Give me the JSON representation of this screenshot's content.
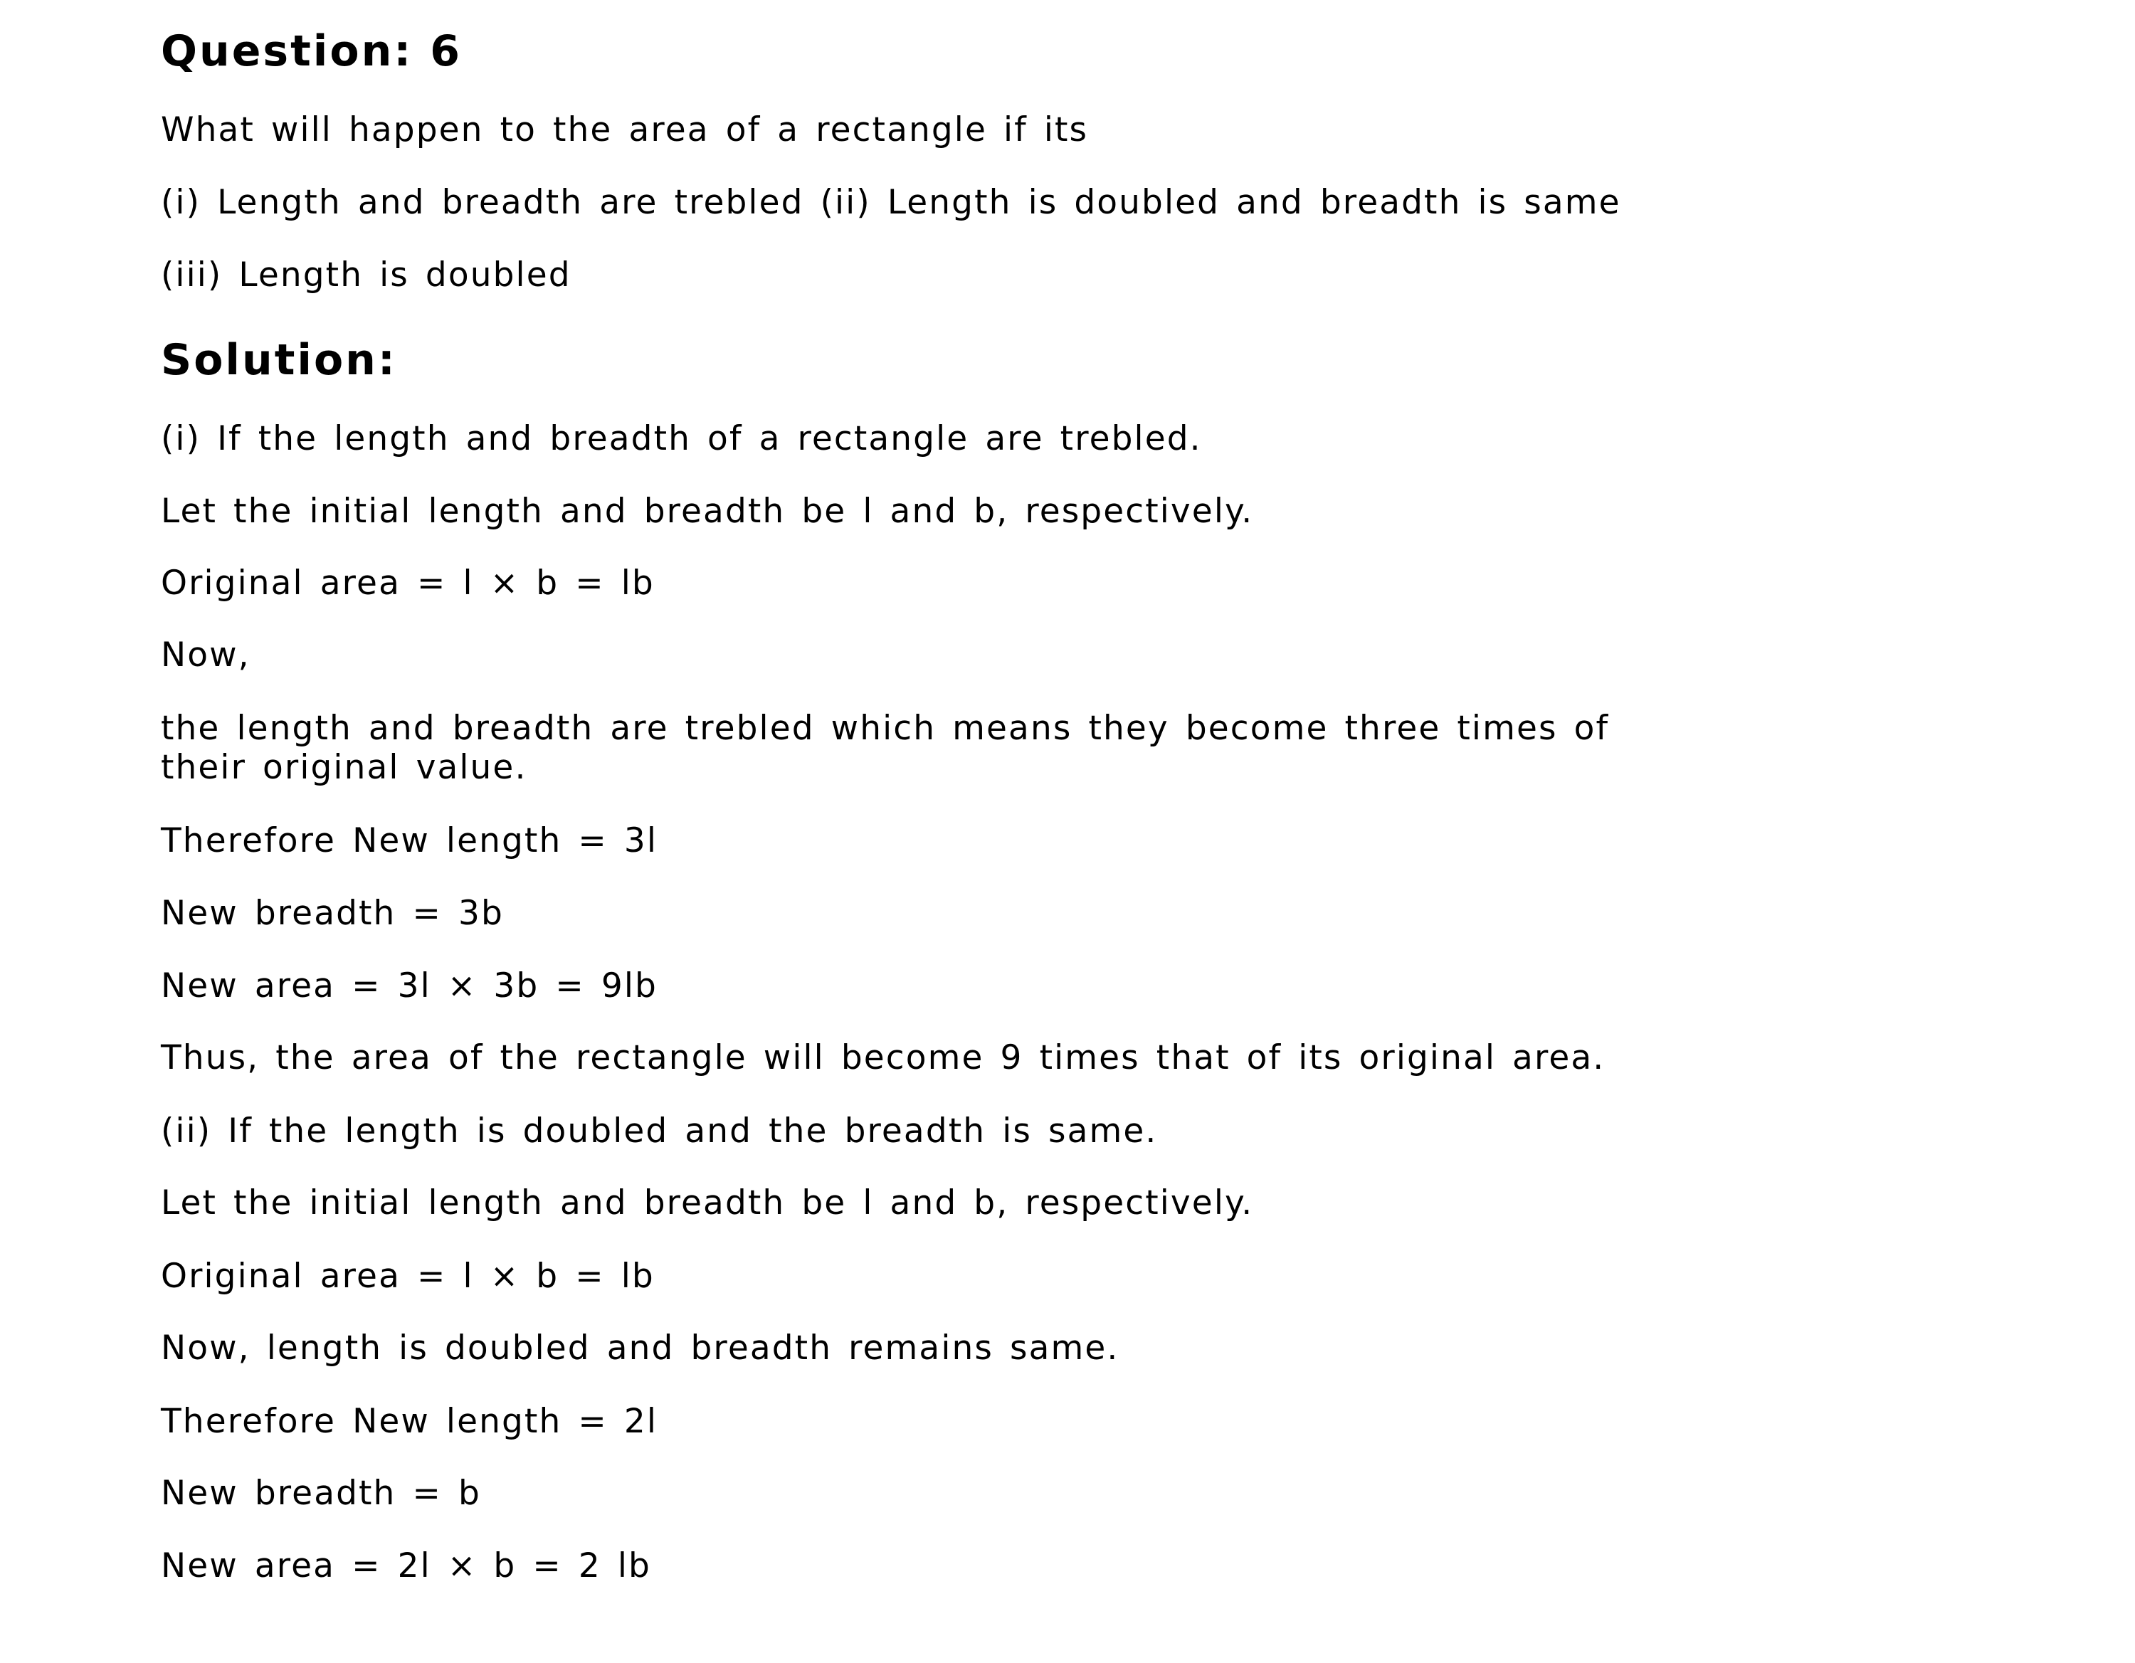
{
  "question": {
    "heading": "Question: 6",
    "lines": [
      "What will happen to the area of a rectangle if its",
      "(i) Length and breadth are trebled (ii) Length is doubled and breadth is same",
      "(iii) Length is doubled"
    ]
  },
  "solution": {
    "heading": "Solution:",
    "lines": [
      "(i) If the length and breadth of a rectangle are trebled.",
      "Let the initial length and breadth be l and b, respectively.",
      "Original area = l × b = lb",
      "Now,",
      "the length and breadth are trebled which means they become three times of",
      "their original value.",
      "Therefore New length = 3l",
      "New breadth = 3b",
      "New area = 3l × 3b = 9lb",
      "Thus, the area of the rectangle will become 9 times that of its original area.",
      "(ii) If the length is doubled and the breadth is same.",
      "Let the initial length and breadth be l and b, respectively.",
      "Original area = l × b = lb",
      "Now, length is doubled and breadth remains same.",
      "Therefore New length = 2l",
      "New breadth = b",
      "New area = 2l × b = 2 lb"
    ]
  }
}
